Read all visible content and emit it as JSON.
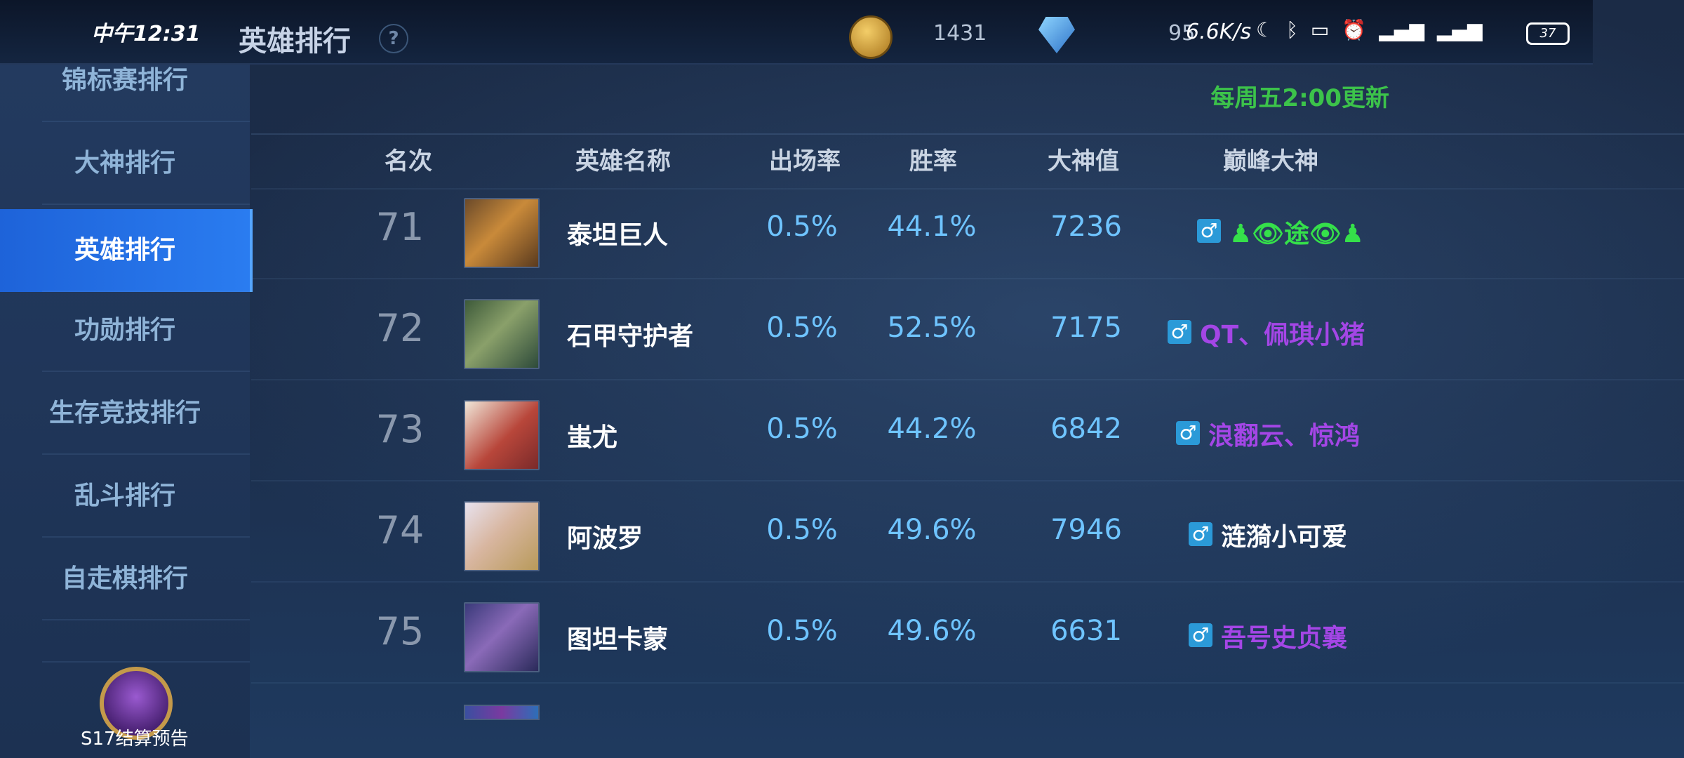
{
  "status_bar": {
    "time": "中午12:31",
    "net_speed": "6.6K/s",
    "battery": "37"
  },
  "header": {
    "title": "英雄排行",
    "help": "?",
    "coins": "1431",
    "diamonds": "95"
  },
  "sidebar": {
    "items": [
      {
        "label": "锦标赛排行",
        "active": false
      },
      {
        "label": "大神排行",
        "active": false
      },
      {
        "label": "英雄排行",
        "active": true
      },
      {
        "label": "功勋排行",
        "active": false
      },
      {
        "label": "生存竞技排行",
        "active": false
      },
      {
        "label": "乱斗排行",
        "active": false
      },
      {
        "label": "自走棋排行",
        "active": false
      },
      {
        "label": "",
        "active": false
      }
    ],
    "season_label": "S17结算预告"
  },
  "main": {
    "update_note": "每周五2:00更新",
    "columns": [
      "名次",
      "英雄名称",
      "出场率",
      "胜率",
      "大神值",
      "巅峰大神"
    ],
    "rows": [
      {
        "rank": "71",
        "hero": "泰坦巨人",
        "pick_rate": "0.5%",
        "win_rate": "44.1%",
        "score": "7236",
        "top_player": "♟👁途👁♟",
        "player_color": "#35e04a"
      },
      {
        "rank": "72",
        "hero": "石甲守护者",
        "pick_rate": "0.5%",
        "win_rate": "52.5%",
        "score": "7175",
        "top_player": "QT、佩琪小猪",
        "player_color": "#a446e6"
      },
      {
        "rank": "73",
        "hero": "蚩尤",
        "pick_rate": "0.5%",
        "win_rate": "44.2%",
        "score": "6842",
        "top_player": "浪翻云、惊鸿",
        "player_color": "#a446e6"
      },
      {
        "rank": "74",
        "hero": "阿波罗",
        "pick_rate": "0.5%",
        "win_rate": "49.6%",
        "score": "7946",
        "top_player": "涟漪小可爱",
        "player_color": "#ffffff"
      },
      {
        "rank": "75",
        "hero": "图坦卡蒙",
        "pick_rate": "0.5%",
        "win_rate": "49.6%",
        "score": "6631",
        "top_player": "吾号史贞襄",
        "player_color": "#a446e6"
      }
    ]
  },
  "icons": {
    "help": "question-circle-icon",
    "coin": "gold-coin-icon",
    "diamond": "diamond-icon",
    "gender": "male-icon"
  }
}
